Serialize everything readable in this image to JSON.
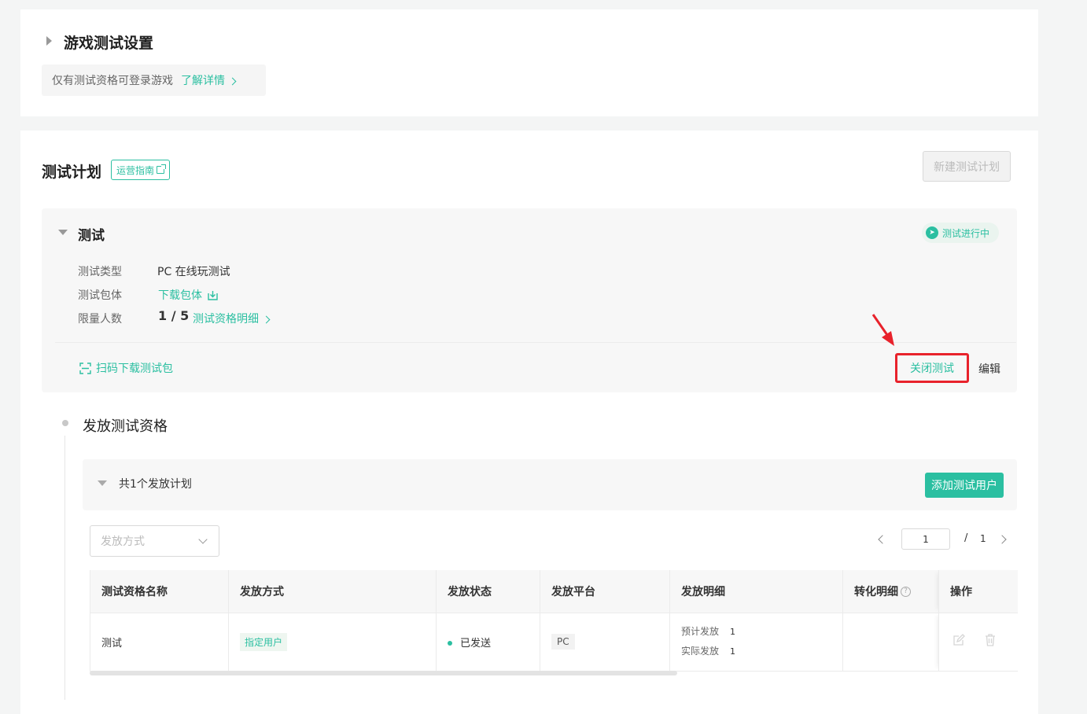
{
  "settings": {
    "title": "游戏测试设置",
    "notice_text": "仅有测试资格可登录游戏",
    "notice_link": "了解详情"
  },
  "plan_section": {
    "title": "测试计划",
    "guide_label": "运营指南",
    "new_plan_label": "新建测试计划"
  },
  "plan": {
    "name": "测试",
    "status": "测试进行中",
    "fields": {
      "type_label": "测试类型",
      "type_value": "PC 在线玩测试",
      "package_label": "测试包体",
      "package_link": "下载包体",
      "limit_label": "限量人数",
      "limit_value": "1 / 5",
      "limit_link": "测试资格明细"
    },
    "scan_label": "扫码下载测试包",
    "close_label": "关闭测试",
    "edit_label": "编辑"
  },
  "distribution": {
    "title": "发放测试资格",
    "summary": "共1个发放计划",
    "add_user_label": "添加测试用户",
    "filter_placeholder": "发放方式",
    "pager": {
      "current": "1",
      "sep": "/",
      "total": "1"
    },
    "columns": [
      "测试资格名称",
      "发放方式",
      "发放状态",
      "发放平台",
      "发放明细",
      "转化明细",
      "操作"
    ],
    "rows": [
      {
        "name": "测试",
        "method": "指定用户",
        "status": "已发送",
        "platform": "PC",
        "planned_label": "预计发放",
        "planned_value": "1",
        "actual_label": "实际发放",
        "actual_value": "1"
      }
    ]
  },
  "colors": {
    "accent": "#2bbfa1",
    "highlight": "#e8222b"
  },
  "icons": [
    "caret-right-icon",
    "chevron-right-icon",
    "external-link-icon",
    "caret-down-icon",
    "send-icon",
    "download-icon",
    "scan-icon",
    "help-icon",
    "edit-icon",
    "trash-icon",
    "arrow-annotation-icon"
  ]
}
